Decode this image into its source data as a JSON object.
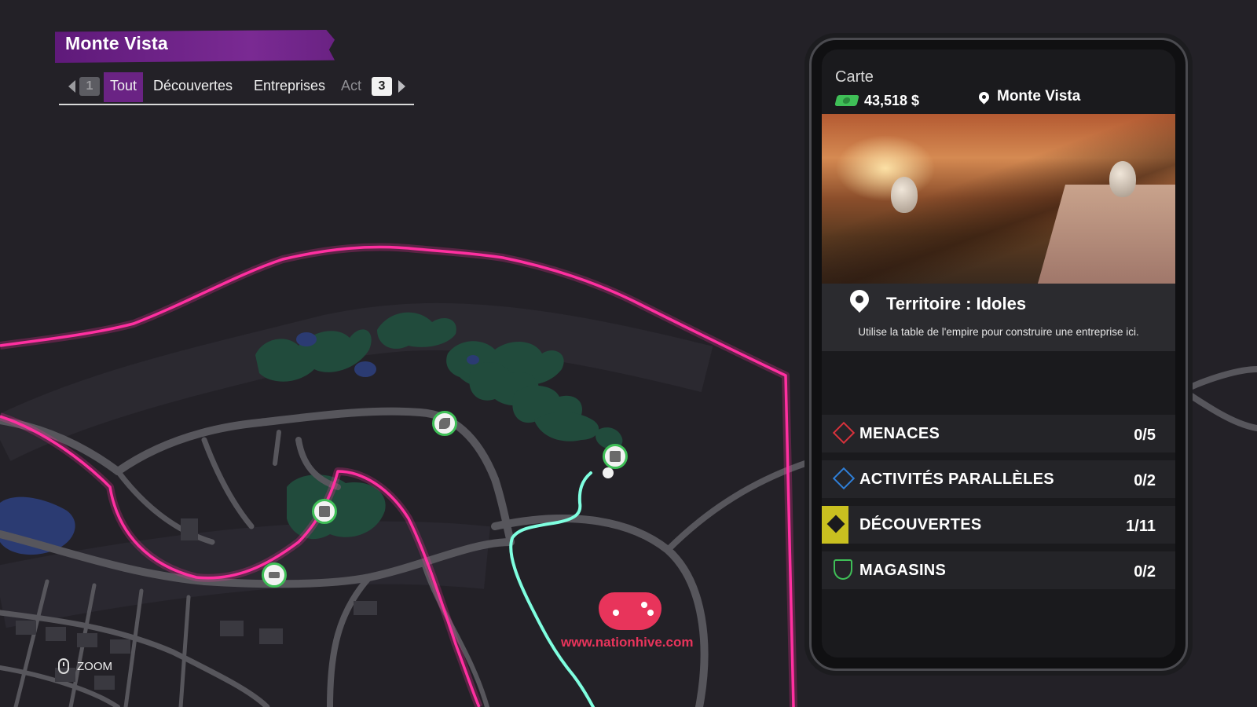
{
  "header": {
    "district": "Monte Vista",
    "tabs": {
      "left_key": "1",
      "right_key": "3",
      "items": [
        {
          "label": "Tout",
          "active": true
        },
        {
          "label": "Découvertes",
          "active": false
        },
        {
          "label": "Entreprises",
          "active": false
        },
        {
          "label": "Act",
          "active": false
        }
      ]
    }
  },
  "phone": {
    "app_title": "Carte",
    "money": "43,518 $",
    "location": "Monte Vista",
    "territory_title": "Territoire : Idoles",
    "territory_desc": "Utilise la table de l'empire pour construire une entreprise ici.",
    "categories": [
      {
        "label": "MENACES",
        "count": "0/5",
        "icon": "diamond-icon",
        "color": "#d8323c"
      },
      {
        "label": "ACTIVITÉS PARALLÈLES",
        "count": "0/2",
        "icon": "diamond-icon",
        "color": "#2f7fd8"
      },
      {
        "label": "DÉCOUVERTES",
        "count": "1/11",
        "icon": "diamond-icon",
        "color": "#c9c020"
      },
      {
        "label": "MAGASINS",
        "count": "0/2",
        "icon": "shield-icon",
        "color": "#3fbf57"
      }
    ]
  },
  "map": {
    "zoom_label": "ZOOM",
    "watermark_url": "www.nationhive.com",
    "colors": {
      "territory_border": "#ff2fa0",
      "route": "#7fffe0",
      "roads": "#57565c",
      "vegetation": "#214b3c"
    }
  }
}
